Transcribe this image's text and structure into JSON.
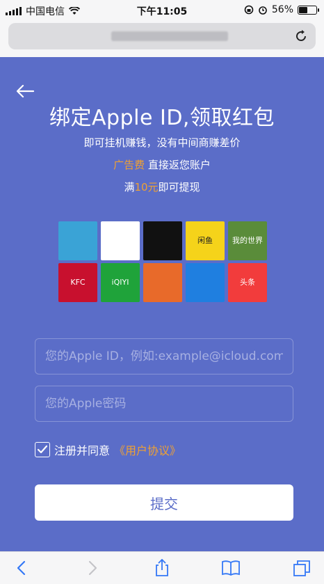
{
  "status_bar": {
    "carrier": "中国电信",
    "time": "下午11:05",
    "battery_percent": "56%",
    "battery_level": 0.56
  },
  "browser": {
    "reload_icon": "reload-icon"
  },
  "page": {
    "back_icon": "back-arrow-icon",
    "title": "绑定Apple ID,领取红包",
    "subtitle1": "即可挂机赚钱，没有中间商赚差价",
    "subtitle2_highlight": "广告费",
    "subtitle2_rest": " 直接返您账户",
    "subtitle3_prefix": "满",
    "subtitle3_highlight": "10元",
    "subtitle3_suffix": "即可提现",
    "apps": [
      {
        "name": "zootopia-app-icon",
        "label": "",
        "color": "#3aa3d6"
      },
      {
        "name": "tencent-video-icon",
        "label": "",
        "color": "#ffffff"
      },
      {
        "name": "tiktok-icon",
        "label": "",
        "color": "#111111"
      },
      {
        "name": "xianyu-icon",
        "label": "闲鱼",
        "color": "#f5d31a"
      },
      {
        "name": "my-world-icon",
        "label": "我的世界",
        "color": "#5a8c3a"
      },
      {
        "name": "kfc-icon",
        "label": "KFC",
        "color": "#c8102e"
      },
      {
        "name": "iqiyi-icon",
        "label": "iQIYI",
        "color": "#1fa33a"
      },
      {
        "name": "shark-game-icon",
        "label": "",
        "color": "#e86a2a"
      },
      {
        "name": "wifi-key-icon",
        "label": "",
        "color": "#1f7fe0"
      },
      {
        "name": "toutiao-icon",
        "label": "头条",
        "color": "#f23c3c"
      }
    ],
    "apple_id_placeholder": "您的Apple ID，例如:example@icloud.com",
    "password_placeholder": "您的Apple密码",
    "agree_text": "注册并同意",
    "agreement_link": "《用户协议》",
    "submit_label": "提交",
    "accent_color": "#5b6dc8",
    "highlight_color": "#f0a132"
  },
  "toolbar": {
    "icons": [
      "back-icon",
      "forward-icon",
      "share-icon",
      "bookmarks-icon",
      "tabs-icon"
    ]
  }
}
